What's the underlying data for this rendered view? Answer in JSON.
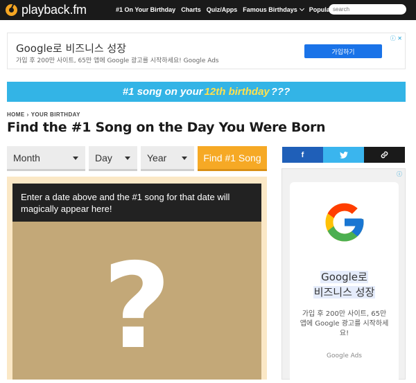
{
  "nav": {
    "logo_text": "playback.fm",
    "links": [
      "#1 On Your Birthday",
      "Charts",
      "Quiz/Apps",
      "Famous Birthdays",
      "Popular"
    ],
    "search_placeholder": "search"
  },
  "ad_top": {
    "title": "Google로 비즈니스 성장",
    "subtitle": "가입 후 200만 사이트, 65만 앱에 Google 광고를 시작하세요! Google Ads",
    "button": "가입하기",
    "choice_icon": "adchoices-icon"
  },
  "banner": {
    "before": "#1 song on your",
    "highlight": "12th birthday",
    "after": "???"
  },
  "breadcrumb": {
    "home": "HOME",
    "sep": "›",
    "current": "YOUR BIRTHDAY"
  },
  "page": {
    "title": "Find the #1 Song on the Day You Were Born"
  },
  "form": {
    "month": "Month",
    "day": "Day",
    "year": "Year",
    "find_button": "Find #1 Song"
  },
  "result": {
    "message": "Enter a date above and the #1 song for that date will magically appear here!",
    "placeholder": "?"
  },
  "share": {
    "facebook": "f",
    "twitter": "twitter-bird-icon",
    "link": "link-icon"
  },
  "ad_side": {
    "title_line1": "Google로",
    "title_line2": "비즈니스 성장",
    "subtitle": "가입 후 200만 사이트, 65만 앱에 Google 광고를 시작하세요!",
    "source": "Google Ads"
  },
  "colors": {
    "nav_bg": "#1a1a1a",
    "accent": "#f6a925",
    "banner": "#33b4e6",
    "facebook": "#1f5fb8",
    "twitter": "#3ab5ee"
  }
}
